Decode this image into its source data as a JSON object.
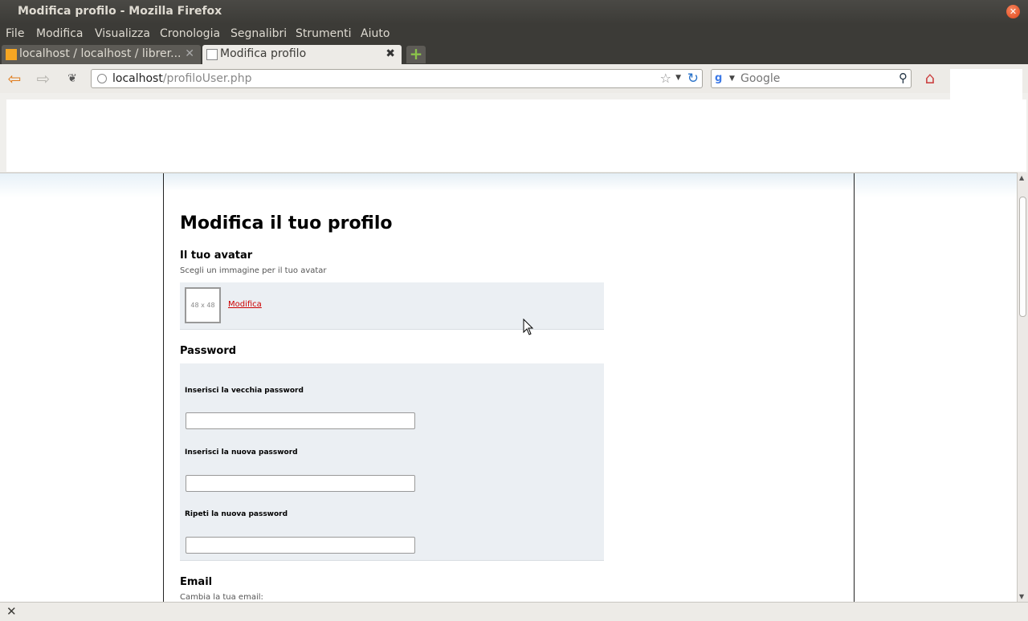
{
  "window": {
    "title": "Modifica profilo - Mozilla Firefox"
  },
  "menu": {
    "items": [
      "File",
      "Modifica",
      "Visualizza",
      "Cronologia",
      "Segnalibri",
      "Strumenti",
      "Aiuto"
    ]
  },
  "tabs": [
    {
      "label": "localhost / localhost / librer...",
      "active": false
    },
    {
      "label": "Modifica profilo",
      "active": true
    }
  ],
  "nav": {
    "url_host": "localhost",
    "url_path": "/profiloUser.php",
    "search_placeholder": "Google"
  },
  "page": {
    "title": "Modifica il tuo profilo",
    "avatar_section": {
      "heading": "Il tuo avatar",
      "hint": "Scegli un immagine per il tuo avatar",
      "placeholder": "48 x 48",
      "edit_link": "Modifica"
    },
    "password_section": {
      "heading": "Password",
      "old_label": "Inserisci la vecchia password",
      "new_label": "Inserisci la nuova password",
      "repeat_label": "Ripeti la nuova password",
      "old_value": "",
      "new_value": "",
      "repeat_value": ""
    },
    "email_section": {
      "heading": "Email",
      "hint": "Cambia la tua email:"
    }
  },
  "colors": {
    "link": "#cc0000",
    "panel": "#ebeff3",
    "titlebar": "#3c3b37"
  }
}
